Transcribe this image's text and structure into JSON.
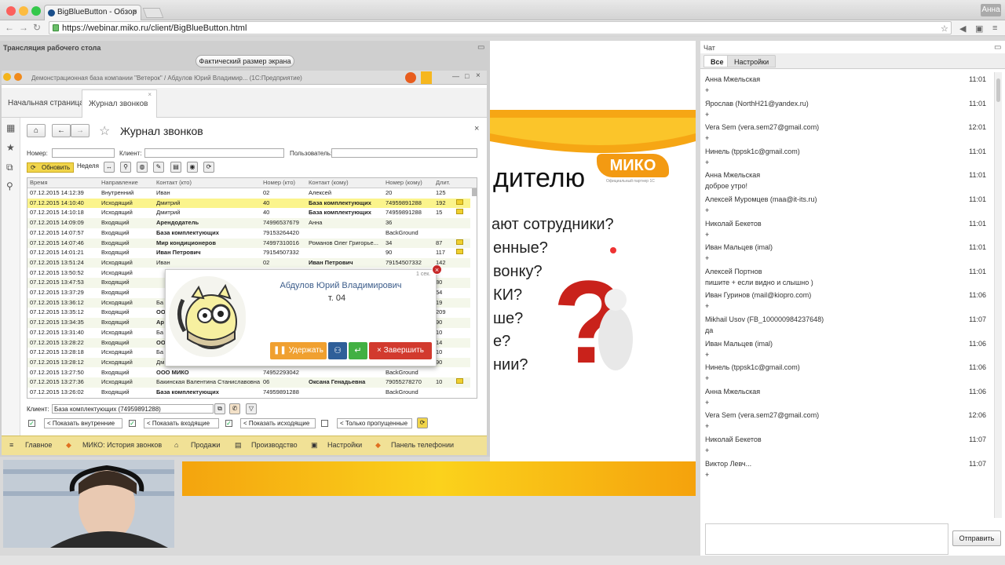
{
  "browser": {
    "tab_title": "BigBlueButton - Обзор",
    "url": "https://webinar.miko.ru/client/BigBlueButton.html",
    "user": "Анна"
  },
  "desktop": {
    "title": "Трансляция рабочего стола",
    "real_size_button": "Фактический размер экрана",
    "window_title": "Демонстрационная база компании \"Ветерок\" / Абдулов Юрий Владимир... (1С:Предприятие)"
  },
  "app": {
    "tabs": [
      "Начальная страница",
      "Журнал звонков"
    ],
    "form_title": "Журнал звонков",
    "filters": {
      "number_label": "Номер:",
      "client_label": "Клиент:",
      "user_label": "Пользователь:"
    },
    "refresh_button": "Обновить",
    "period": "Неделя",
    "columns": [
      "Время",
      "Направление",
      "Контакт (кто)",
      "Номер (кто)",
      "Контакт (кому)",
      "Номер (кому)",
      "Длит."
    ],
    "rows": [
      [
        "07.12.2015 14:12:39",
        "Внутренний",
        "Иван",
        "02",
        "Алексей",
        "20",
        "125"
      ],
      [
        "07.12.2015 14:10:40",
        "Исходящий",
        "Дмитрий",
        "40",
        "База комплектующих",
        "74959891288",
        "192"
      ],
      [
        "07.12.2015 14:10:18",
        "Исходящий",
        "Дмитрий",
        "40",
        "База комплектующих",
        "74959891288",
        "15"
      ],
      [
        "07.12.2015 14:09:09",
        "Входящий",
        "Арендодатель",
        "74996537679",
        "Анна",
        "36",
        ""
      ],
      [
        "07.12.2015 14:07:57",
        "Входящий",
        "База комплектующих",
        "79153264420",
        "",
        "BackGround",
        ""
      ],
      [
        "07.12.2015 14:07:46",
        "Входящий",
        "Мир кондиционеров",
        "74997310016",
        "Романов Олег Григорье...",
        "34",
        "87"
      ],
      [
        "07.12.2015 14:01:21",
        "Входящий",
        "Иван Петрович",
        "79154507332",
        "",
        "90",
        "117"
      ],
      [
        "07.12.2015 13:51:24",
        "Исходящий",
        "Иван",
        "02",
        "Иван Петрович",
        "79154507332",
        "142"
      ],
      [
        "07.12.2015 13:50:52",
        "Исходящий",
        "",
        "",
        "",
        "",
        ""
      ],
      [
        "07.12.2015 13:47:53",
        "Входящий",
        "",
        "",
        "",
        "",
        "80"
      ],
      [
        "07.12.2015 13:37:29",
        "Входящий",
        "",
        "",
        "",
        "",
        "54"
      ],
      [
        "07.12.2015 13:36:12",
        "Исходящий",
        "Ба",
        "",
        "",
        "",
        "19"
      ],
      [
        "07.12.2015 13:35:12",
        "Входящий",
        "ОО",
        "",
        "",
        "",
        "209"
      ],
      [
        "07.12.2015 13:34:35",
        "Входящий",
        "Ар",
        "",
        "",
        "",
        "90"
      ],
      [
        "07.12.2015 13:31:40",
        "Исходящий",
        "Ба",
        "",
        "",
        "",
        "10"
      ],
      [
        "07.12.2015 13:28:22",
        "Входящий",
        "ОО",
        "",
        "",
        "",
        "14"
      ],
      [
        "07.12.2015 13:28:18",
        "Исходящий",
        "Ба",
        "",
        "",
        "",
        "10"
      ],
      [
        "07.12.2015 13:28:12",
        "Исходящий",
        "Дм",
        "",
        "",
        "",
        "90"
      ],
      [
        "07.12.2015 13:27:50",
        "Входящий",
        "ООО МИКО",
        "74952293042",
        "",
        "BackGround",
        ""
      ],
      [
        "07.12.2015 13:27:36",
        "Исходящий",
        "Бакинская Валентина Станиславовна",
        "06",
        "Оксана Генадьевна",
        "79055278270",
        "10"
      ],
      [
        "07.12.2015 13:26:02",
        "Входящий",
        "База комплектующих",
        "74959891288",
        "",
        "BackGround",
        ""
      ]
    ],
    "client_label": "Клиент:",
    "client_value": "База комплектующих (74959891288)",
    "show_filters": [
      "< Показать внутренние",
      "< Показать входящие",
      "< Показать исходящие",
      "< Только пропущенные"
    ],
    "bottom_menu": [
      "Главное",
      "МИКО: История звонков",
      "Продажи",
      "Производство",
      "Настройки",
      "Панель телефонии"
    ]
  },
  "popup": {
    "elapsed": "1 сек.",
    "caller_name": "Абдулов Юрий Владимирович",
    "extension": "т. 04",
    "hold_button": "Удержать",
    "end_button": "Завершить"
  },
  "presentation": {
    "heading": "дителю",
    "lines": [
      "ают сотрудники?",
      "енные?",
      "вонку?",
      "КИ?",
      "ше?",
      "е?",
      "нии?"
    ],
    "logo": "МИКО",
    "logo_sub": "Официальный партнер 1С"
  },
  "chat": {
    "title": "Чат",
    "tabs": [
      "Все",
      "Настройки"
    ],
    "messages": [
      {
        "user": "Анна Мжельская",
        "time": "11:01",
        "text": "+"
      },
      {
        "user": "Ярослав (NorthH21@yandex.ru)",
        "time": "11:01",
        "text": "+"
      },
      {
        "user": "Vera Sem (vera.sem27@gmail.com)",
        "time": "12:01",
        "text": "+"
      },
      {
        "user": "Нинель (tppsk1c@gmail.com)",
        "time": "11:01",
        "text": "+"
      },
      {
        "user": "Анна Мжельская",
        "time": "11:01",
        "text": "доброе утро!"
      },
      {
        "user": "Алексей Муромцев (maa@it-its.ru)",
        "time": "11:01",
        "text": "+"
      },
      {
        "user": "Николай Бекетов",
        "time": "11:01",
        "text": "+"
      },
      {
        "user": "Иван Мальцев (imal)",
        "time": "11:01",
        "text": "+"
      },
      {
        "user": "Алексей Портнов",
        "time": "11:01",
        "text": "пишите + если видно и слышно )"
      },
      {
        "user": "Иван Гуринов (mail@kiopro.com)",
        "time": "11:06",
        "text": "+"
      },
      {
        "user": "Mikhail Usov (FB_100000984237648)",
        "time": "11:07",
        "text": "да"
      },
      {
        "user": "Иван Мальцев (imal)",
        "time": "11:06",
        "text": "+"
      },
      {
        "user": "Нинель (tppsk1c@gmail.com)",
        "time": "11:06",
        "text": "+"
      },
      {
        "user": "Анна Мжельская",
        "time": "11:06",
        "text": "+"
      },
      {
        "user": "Vera Sem (vera.sem27@gmail.com)",
        "time": "12:06",
        "text": "+"
      },
      {
        "user": "Николай Бекетов",
        "time": "11:07",
        "text": "+"
      },
      {
        "user": "Виктор Левч...",
        "time": "11:07",
        "text": "+"
      }
    ],
    "send_button": "Отправить"
  }
}
